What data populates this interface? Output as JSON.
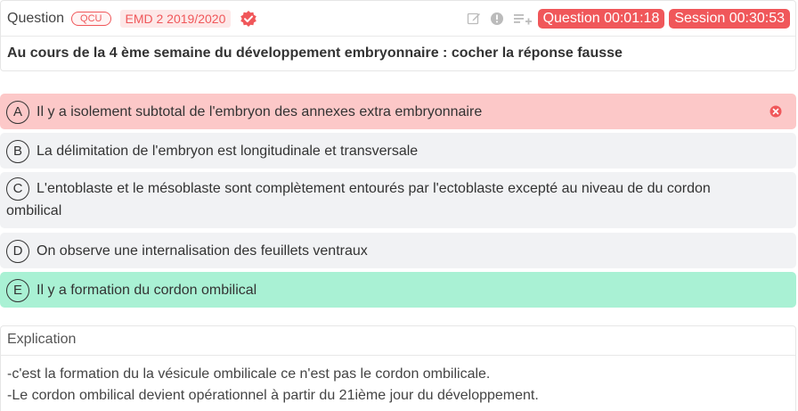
{
  "question": {
    "title": "Question",
    "type_badge": "QCU",
    "source": "EMD 2 2019/2020",
    "timer_question": "Question 00:01:18",
    "timer_session": "Session 00:30:53",
    "text": "Au cours de la 4 ème semaine du développement embryonnaire : cocher la réponse fausse"
  },
  "options": [
    {
      "letter": "A",
      "text": "Il y a isolement subtotal de l'embryon des annexes extra embryonnaire",
      "state": "wrong"
    },
    {
      "letter": "B",
      "text": "La délimitation de l'embryon est longitudinale et transversale",
      "state": "neutral"
    },
    {
      "letter": "C",
      "text": "L'entoblaste et le mésoblaste sont complètement entourés par l'ectoblaste excepté au niveau de du cordon ombilical",
      "state": "neutral"
    },
    {
      "letter": "D",
      "text": "On observe une internalisation des feuillets ventraux",
      "state": "neutral"
    },
    {
      "letter": "E",
      "text": "Il y a formation du cordon ombilical",
      "state": "correct"
    }
  ],
  "explanation": {
    "title": "Explication",
    "lines": [
      "-c'est la formation du la vésicule ombilicale ce n'est pas le cordon ombilicale.",
      "-Le cordon ombilical devient opérationnel à partir du 21ième jour du développement."
    ]
  },
  "colors": {
    "accent": "#f0575a",
    "wrong_bg": "#fcc8c8",
    "correct_bg": "#a9f1d4",
    "neutral_bg": "#f1f2f4"
  },
  "icons": [
    "verified-icon",
    "edit-icon",
    "info-icon",
    "playlist-add-icon",
    "close-circle-icon"
  ]
}
